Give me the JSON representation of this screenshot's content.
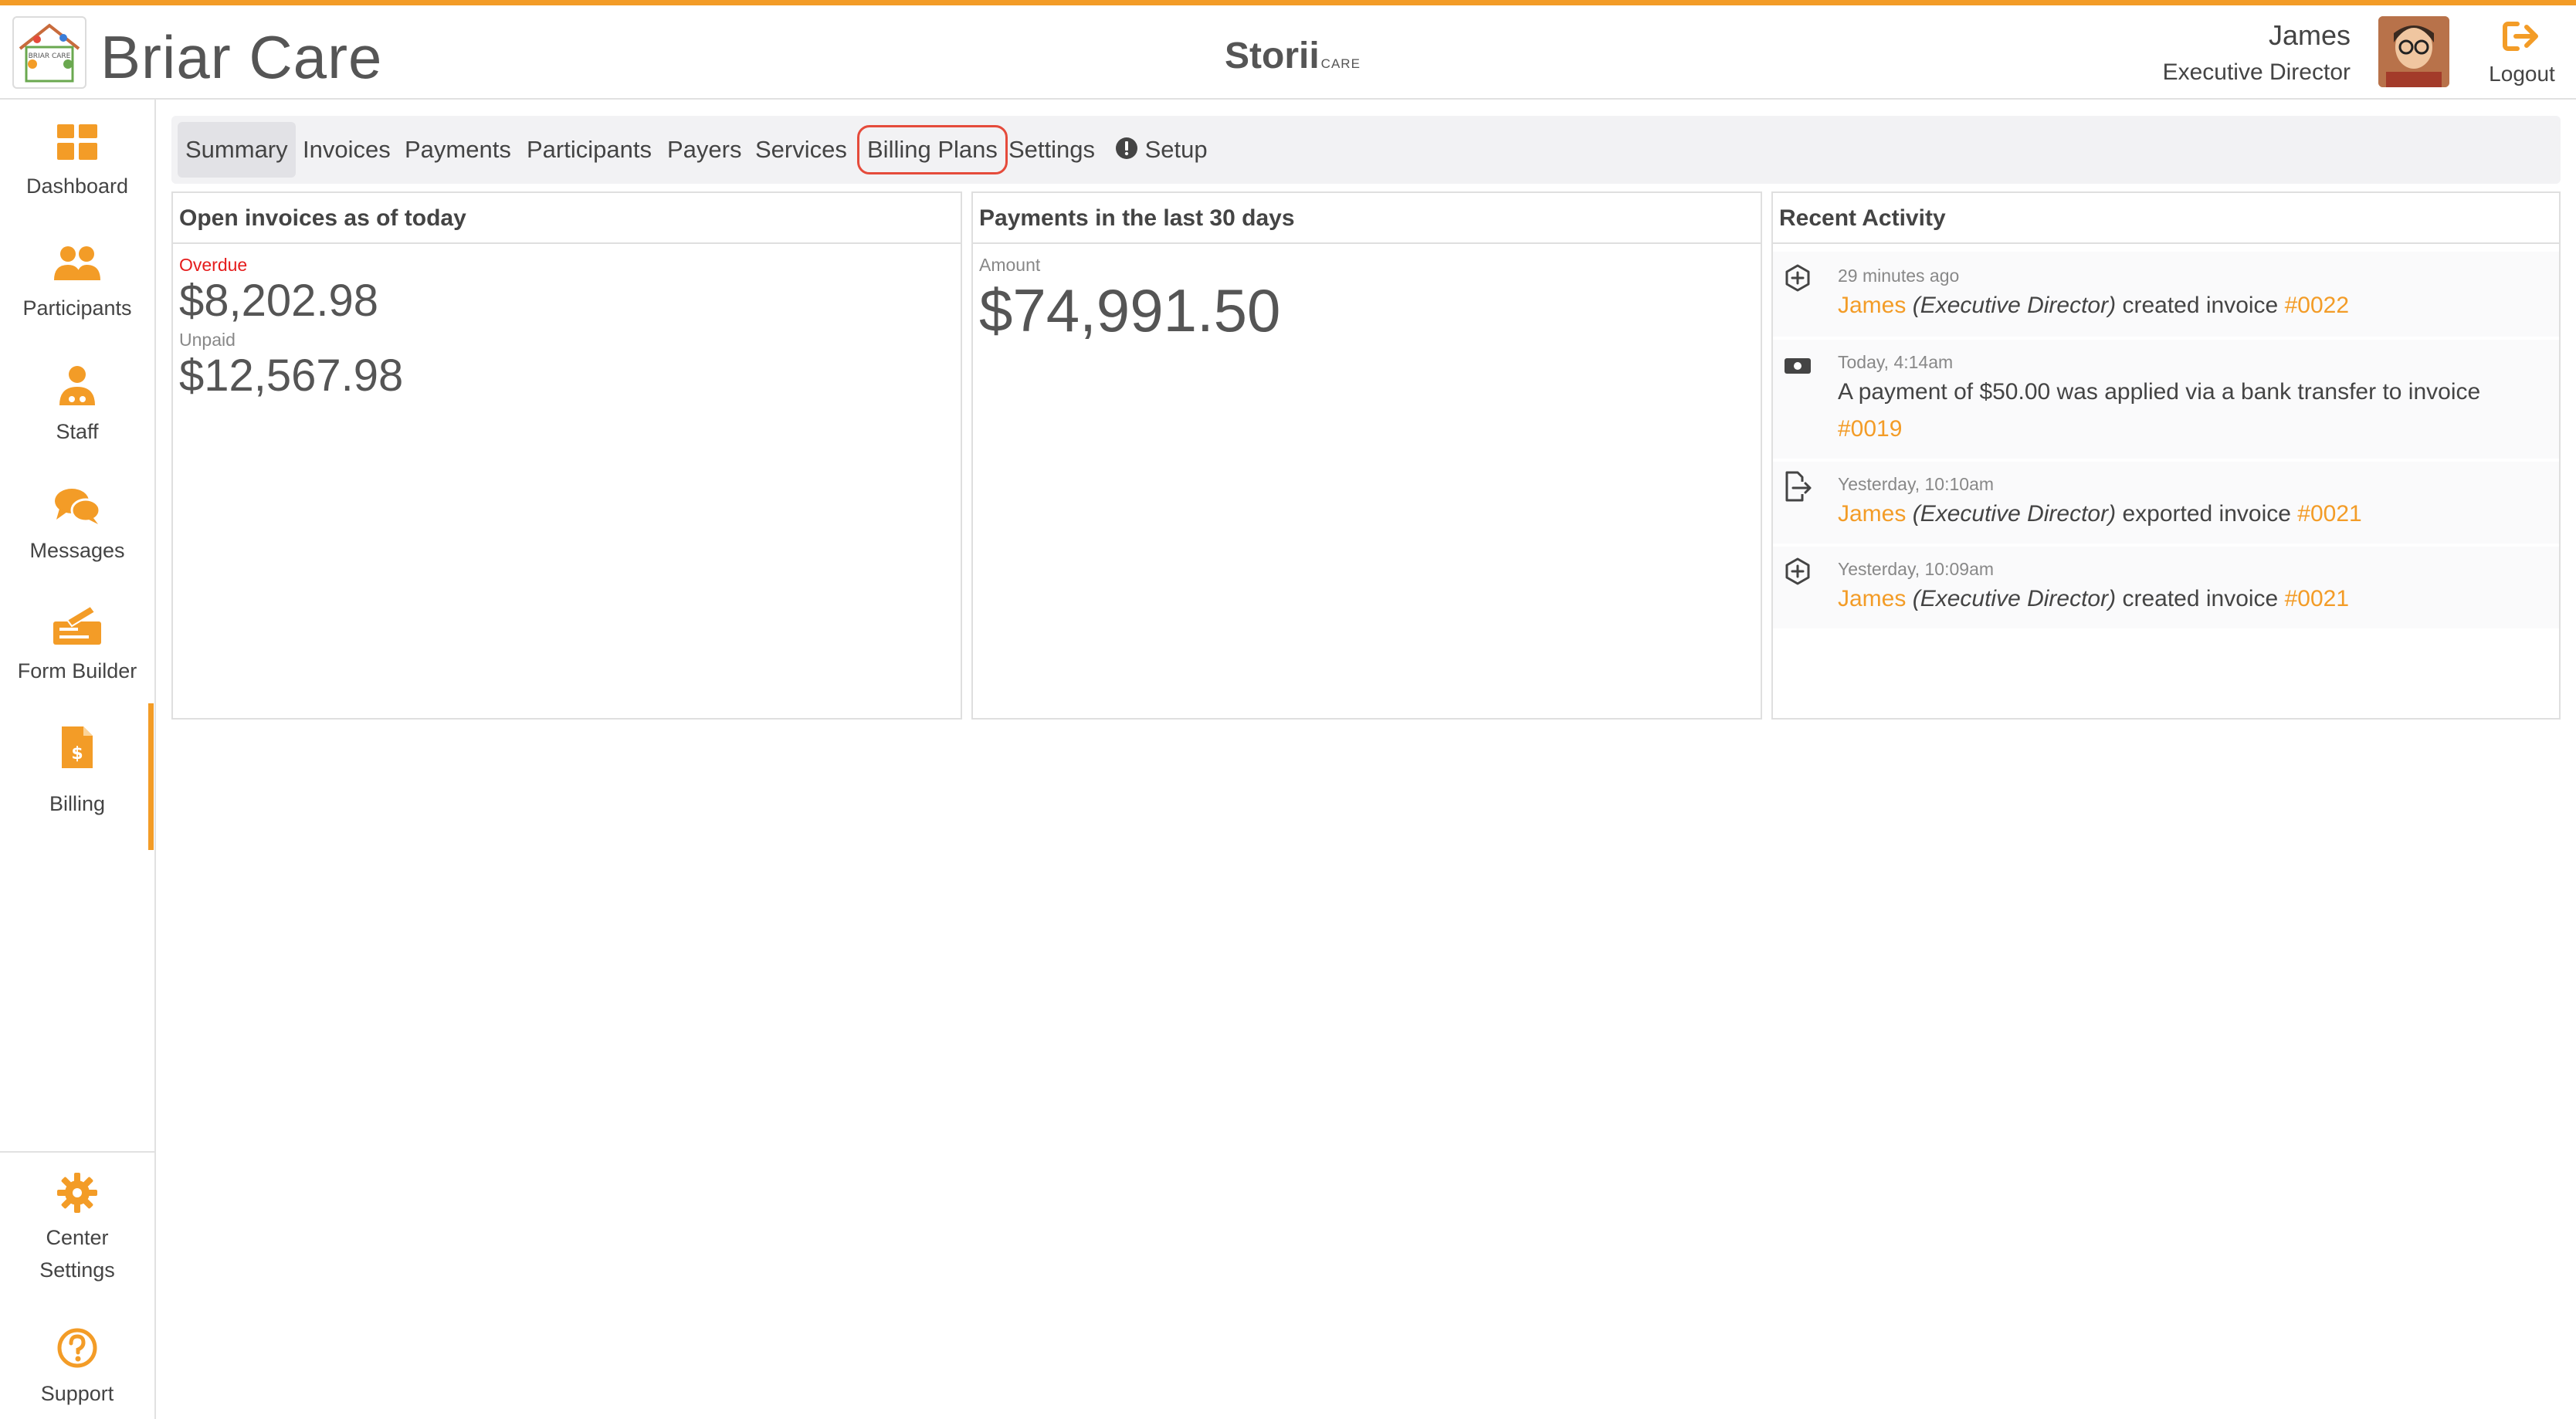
{
  "header": {
    "brand": "Briar Care",
    "logo_text": "BRIAR CARE",
    "product_name": "Storii",
    "product_suffix": "CARE",
    "user_name": "James",
    "user_role": "Executive Director",
    "logout_label": "Logout"
  },
  "sidebar": {
    "items": [
      {
        "label": "Dashboard",
        "icon": "grid-icon"
      },
      {
        "label": "Participants",
        "icon": "people-icon"
      },
      {
        "label": "Staff",
        "icon": "staff-icon"
      },
      {
        "label": "Messages",
        "icon": "chat-icon"
      },
      {
        "label": "Form Builder",
        "icon": "form-builder-icon"
      },
      {
        "label": "Billing",
        "icon": "billing-icon",
        "active": true
      }
    ],
    "bottom": [
      {
        "label_line1": "Center",
        "label_line2": "Settings",
        "icon": "gear-icon"
      },
      {
        "label": "Support",
        "icon": "question-icon"
      }
    ]
  },
  "tabs": [
    {
      "label": "Summary",
      "active": true
    },
    {
      "label": "Invoices"
    },
    {
      "label": "Payments"
    },
    {
      "label": "Participants"
    },
    {
      "label": "Payers"
    },
    {
      "label": "Services"
    },
    {
      "label": "Billing Plans",
      "highlighted": true
    },
    {
      "label": "Settings"
    },
    {
      "label": "Setup",
      "icon": "alert-icon"
    }
  ],
  "open_invoices": {
    "title": "Open invoices as of today",
    "overdue_label": "Overdue",
    "overdue_amount": "$8,202.98",
    "unpaid_label": "Unpaid",
    "unpaid_amount": "$12,567.98"
  },
  "payments": {
    "title": "Payments in the last 30 days",
    "amount_label": "Amount",
    "amount": "$74,991.50"
  },
  "recent_activity": {
    "title": "Recent Activity",
    "items": [
      {
        "icon": "plus-hexagon-icon",
        "time": "29 minutes ago",
        "actor": "James",
        "role": "(Executive Director)",
        "action": "created invoice",
        "ref": "#0022"
      },
      {
        "icon": "money-icon",
        "time": "Today, 4:14am",
        "text": "A payment of $50.00 was applied via a bank transfer to invoice",
        "ref": "#0019"
      },
      {
        "icon": "export-icon",
        "time": "Yesterday, 10:10am",
        "actor": "James",
        "role": "(Executive Director)",
        "action": "exported invoice",
        "ref": "#0021"
      },
      {
        "icon": "plus-hexagon-icon",
        "time": "Yesterday, 10:09am",
        "actor": "James",
        "role": "(Executive Director)",
        "action": "created invoice",
        "ref": "#0021"
      }
    ]
  },
  "colors": {
    "accent": "#f39c27",
    "overdue": "#e51c1c",
    "highlight_ring": "#e54b3b"
  }
}
